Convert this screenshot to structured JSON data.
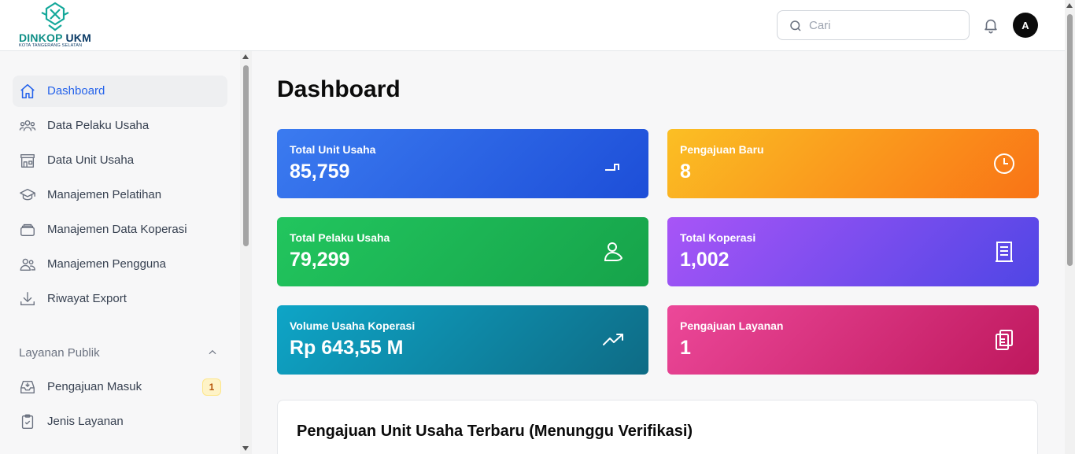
{
  "brand": {
    "name": "DINKOP",
    "name_suffix": "UKM",
    "subtitle": "KOTA TANGERANG SELATAN"
  },
  "header": {
    "search_placeholder": "Cari",
    "avatar_initial": "A"
  },
  "sidebar": {
    "items": [
      {
        "label": "Dashboard",
        "icon": "home-icon",
        "active": true
      },
      {
        "label": "Data Pelaku Usaha",
        "icon": "users-icon"
      },
      {
        "label": "Data Unit Usaha",
        "icon": "store-icon"
      },
      {
        "label": "Manajemen Pelatihan",
        "icon": "graduation-cap-icon"
      },
      {
        "label": "Manajemen Data Koperasi",
        "icon": "layers-icon"
      },
      {
        "label": "Manajemen Pengguna",
        "icon": "user-group-icon"
      },
      {
        "label": "Riwayat Export",
        "icon": "download-icon"
      }
    ],
    "section": {
      "label": "Layanan Publik",
      "icon": "chevron-up-icon"
    },
    "section_items": [
      {
        "label": "Pengajuan Masuk",
        "icon": "inbox-icon",
        "badge": "1"
      },
      {
        "label": "Jenis Layanan",
        "icon": "clipboard-check-icon"
      }
    ]
  },
  "main": {
    "title": "Dashboard",
    "cards": [
      {
        "label": "Total Unit Usaha",
        "value": "85,759",
        "icon": "step-chart-icon",
        "color": "#2563eb"
      },
      {
        "label": "Pengajuan Baru",
        "value": "8",
        "icon": "clock-icon",
        "color": "#f59e0b"
      },
      {
        "label": "Total Pelaku Usaha",
        "value": "79,299",
        "icon": "user-icon",
        "color": "#16a34a"
      },
      {
        "label": "Total Koperasi",
        "value": "1,002",
        "icon": "document-icon",
        "color": "#7c3aed"
      },
      {
        "label": "Volume Usaha Koperasi",
        "value": "Rp 643,55 M",
        "icon": "trending-up-icon",
        "color": "#0891b2"
      },
      {
        "label": "Pengajuan Layanan",
        "value": "1",
        "icon": "clipboard-icon",
        "color": "#db2777"
      }
    ],
    "panel_title": "Pengajuan Unit Usaha Terbaru (Menunggu Verifikasi)"
  }
}
